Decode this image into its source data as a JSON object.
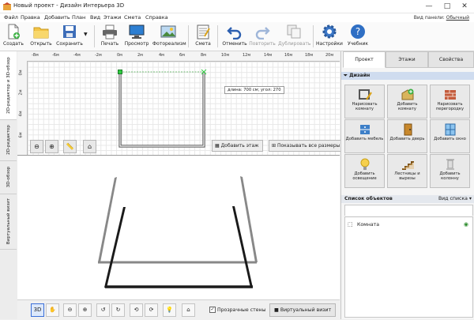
{
  "window": {
    "title": "Новый проект - Дизайн Интерьера 3D",
    "controls": [
      "—",
      "□",
      "✕"
    ]
  },
  "menu": {
    "items": [
      "Файл",
      "Правка",
      "Добавить",
      "План",
      "Вид",
      "Этажи",
      "Смета",
      "Справка"
    ],
    "panel_view_label": "Вид панели:",
    "panel_view_value": "Обычный"
  },
  "toolbar": {
    "buttons": [
      "Создать",
      "Открыть",
      "Сохранить",
      "Печать",
      "Просмотр",
      "Фотореализм",
      "Смета",
      "Отменить",
      "Повторить",
      "Дублировать",
      "Настройки",
      "Учебник"
    ]
  },
  "left_tabs": [
    "2D-редактор и 3D-обзор",
    "2D-редактор",
    "3D-обзор",
    "Виртуальный визит"
  ],
  "editor2d": {
    "ruler_x": [
      "-8м",
      "-6м",
      "-4м",
      "-2м",
      "0м",
      "2м",
      "4м",
      "6м",
      "8м",
      "10м",
      "12м",
      "14м",
      "16м",
      "18м",
      "20м",
      "22м"
    ],
    "ruler_y": [
      "0м",
      "2м",
      "4м",
      "6м"
    ],
    "tooltip": "длина: 700 см; угол: 270",
    "add_floor": "Добавить этаж",
    "show_sizes": "Показывать все размеры"
  },
  "bottom": {
    "transparent_walls": "Прозрачные стены",
    "virtual_visit": "Виртуальный визит",
    "transparent_checked": true
  },
  "right_panel": {
    "tabs": [
      "Проект",
      "Этажи",
      "Свойства"
    ],
    "active_tab": "Проект",
    "design_header": "Дизайн",
    "design_buttons": [
      {
        "label": "Нарисовать комнату",
        "icon": "draw-room-icon"
      },
      {
        "label": "Добавить комнату",
        "icon": "add-room-icon"
      },
      {
        "label": "Нарисовать перегородку",
        "icon": "draw-wall-icon"
      },
      {
        "label": "Добавить мебель",
        "icon": "furniture-icon"
      },
      {
        "label": "Добавить дверь",
        "icon": "door-icon"
      },
      {
        "label": "Добавить окно",
        "icon": "window-icon"
      },
      {
        "label": "Добавить освещение",
        "icon": "light-bulb-icon"
      },
      {
        "label": "Лестницы и вырезы",
        "icon": "stairs-icon"
      },
      {
        "label": "Добавить колонну",
        "icon": "column-icon"
      }
    ],
    "objects_header": "Список объектов",
    "objects_view_label": "Вид списка",
    "objects": [
      "Комната"
    ]
  },
  "colors": {
    "accent": "#3a6fd8",
    "section_header": "#cfdcef",
    "selection": "#4caf50"
  }
}
